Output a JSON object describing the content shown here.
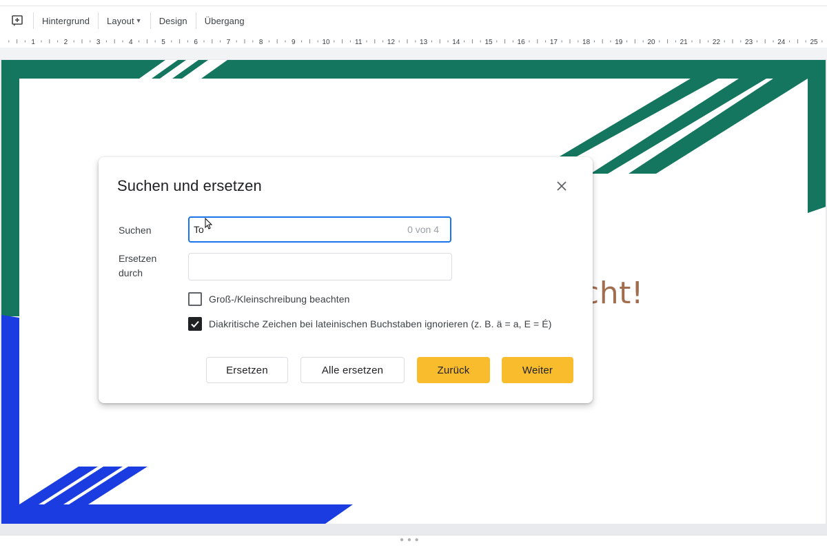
{
  "toolbar": {
    "add_icon": "add-comment-icon",
    "items": [
      {
        "label": "Hintergrund"
      },
      {
        "label": "Layout"
      },
      {
        "label": "Design"
      },
      {
        "label": "Übergang"
      }
    ]
  },
  "ruler": {
    "numbers": [
      "1",
      "2",
      "3",
      "4",
      "5",
      "6",
      "7",
      "8",
      "9",
      "10",
      "11",
      "12",
      "13",
      "14",
      "15",
      "16",
      "17",
      "18",
      "19",
      "20",
      "21",
      "22",
      "23",
      "24",
      "25"
    ]
  },
  "slide": {
    "visible_text": "cht!",
    "colors": {
      "green": "#14765f",
      "blue": "#1a3ce0",
      "text": "#a06e4e"
    }
  },
  "dialog": {
    "title": "Suchen und ersetzen",
    "close_icon": "close-icon",
    "find_label": "Suchen",
    "find_value": "To",
    "match_count": "0 von 4",
    "replace_label": "Ersetzen durch",
    "replace_value": "",
    "options": [
      {
        "label": "Groß-/Kleinschreibung beachten",
        "checked": false
      },
      {
        "label": "Diakritische Zeichen bei lateinischen Buchstaben ignorieren (z. B. ä = a, E = É)",
        "checked": true
      }
    ],
    "buttons": {
      "replace": "Ersetzen",
      "replace_all": "Alle ersetzen",
      "previous": "Zurück",
      "next": "Weiter"
    }
  }
}
